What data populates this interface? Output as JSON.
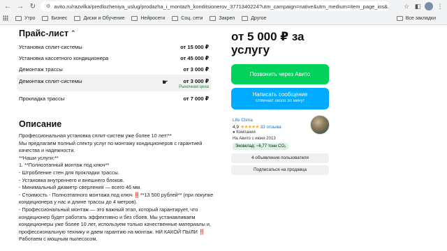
{
  "browser": {
    "url": "avito.ru/razvilka/predlozheniya_uslug/prodazha_i_montazh_konditsionerov_3771340224?utm_campaign=native&utm_medium=item_page_ios&...",
    "bookmarks": [
      "Утро",
      "Бизнес",
      "Диски и Обучение",
      "Нейросети",
      "Соц. сети",
      "Закреп",
      "Другое"
    ],
    "all_bookmarks": "Все закладки"
  },
  "price_list": {
    "title": "Прайс-лист",
    "rows": [
      {
        "name": "Установка сплит-системы",
        "value": "от 15 000 ₽",
        "note": ""
      },
      {
        "name": "Установка кассетного кондиционера",
        "value": "от 45 000 ₽",
        "note": ""
      },
      {
        "name": "Демонтаж трассы",
        "value": "от 3 000 ₽",
        "note": ""
      },
      {
        "name": "Демонтаж сплит-системы",
        "value": "от 3 000 ₽",
        "note": "Рыночная цена"
      },
      {
        "name": "Прокладка трассы",
        "value": "от 7 000 ₽",
        "note": ""
      }
    ]
  },
  "description": {
    "title": "Описание",
    "lines": [
      "Профессиональная установка сплит-систем уже более 10 лет!**",
      "Мы предлагаем полный спектр услуг по монтажу кондиционеров с гарантией качества и надежности.",
      "",
      "**Наши услуги:**",
      "1. **Полноэтапный монтаж под ключ**",
      "- Штробление стен для прокладки трассы.",
      "- Установка внутреннего и внешнего блоков.",
      "- Минимальный диаметр сверления — всего 46 мм.",
      "- Стоимость - Полноэтапного монтажа под ключ ‼️**13 500 рублей** (при покупке кондиционера у нас и длине трассы до 4 метров).",
      "- Профессиональный монтаж — это важный этап, который гарантирует, что кондиционер будет работать эффективно и без сбоев. Мы устанавливаем кондиционеры уже более 10 лет, используем только качественные материалы и, профессиональную технику и даем гарантию на монтаж. НИ КАКОЙ ПЫЛИ ‼️",
      "Работаем с мощным пылесосом."
    ]
  },
  "sidebar": {
    "price": "от 5 000 ₽ за услугу",
    "call_button": "Позвонить через Авито",
    "message_button": "Написать сообщение",
    "message_sub": "Отвечает около 30 минут",
    "seller": {
      "name": "Life Clima",
      "rating": "4,9",
      "stars": "★★★★★",
      "reviews": "33 отзыва",
      "type": "Компания",
      "since": "На Авито с июня 2013",
      "eco": "Эковклад: ~6,77 тонн CO₂"
    },
    "listings_button": "4 объявления пользователя",
    "subscribe_button": "Подписаться на продавца"
  },
  "colors": {
    "call": "#02d15c",
    "message": "#00aaff",
    "link": "#0a7bd6",
    "market": "#0f8a3d"
  }
}
